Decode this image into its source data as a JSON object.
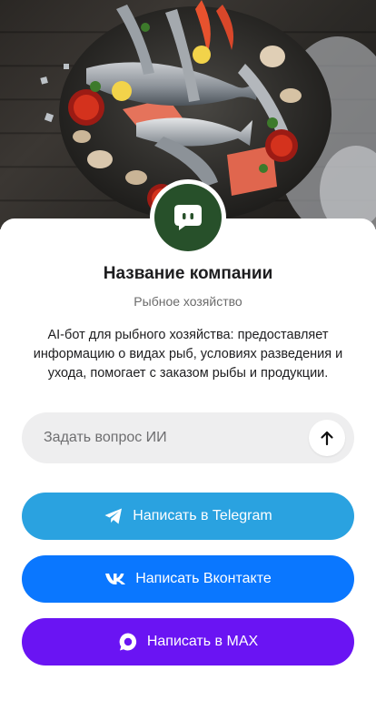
{
  "company": {
    "name": "Название компании",
    "category": "Рыбное хозяйство",
    "description": "AI-бот для рыбного хозяйства: предоставляет информацию о видах рыб, условиях разведения и ухода, помогает с заказом рыбы и продукции."
  },
  "ask": {
    "placeholder": "Задать вопрос ИИ",
    "send_icon": "arrow-up-icon"
  },
  "buttons": {
    "telegram": {
      "label": "Написать в Telegram",
      "icon": "telegram-icon",
      "color": "#2aa2e0"
    },
    "vk": {
      "label": "Написать Вконтакте",
      "icon": "vk-icon",
      "color": "#0a77ff"
    },
    "max": {
      "label": "Написать в MAX",
      "icon": "max-icon",
      "color": "#6a14f3"
    }
  },
  "avatar": {
    "icon": "chat-bot-icon",
    "color": "#27502a"
  },
  "hero": {
    "icon": "seafood-platter-image"
  }
}
